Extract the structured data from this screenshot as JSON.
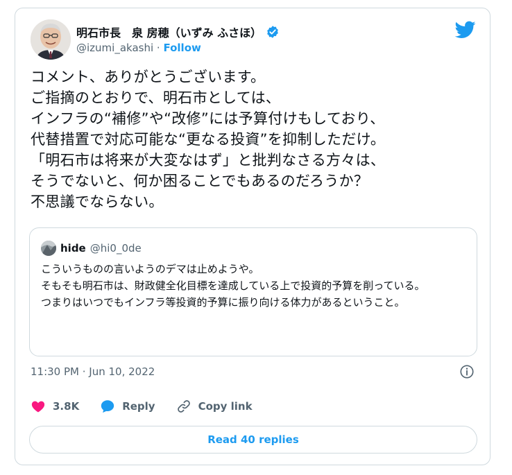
{
  "author": {
    "display_name": "明石市長　泉 房穂（いずみ ふさほ）",
    "handle": "@izumi_akashi",
    "separator": "·",
    "follow_label": "Follow"
  },
  "tweet": {
    "text": "コメント、ありがとうございます。\nご指摘のとおりで、明石市としては、\nインフラの“補修”や“改修”には予算付けもしており、\n代替措置で対応可能な“更なる投資”を抑制しただけ。\n「明石市は将来が大変なはず」と批判なさる方々は、\nそうでないと、何か困ることでもあるのだろうか？\n不思議でならない。",
    "timestamp": "11:30 PM · Jun 10, 2022"
  },
  "quoted_tweet": {
    "name": "hide",
    "handle": "@hi0_0de",
    "text": "こういうものの言いようのデマは止めようや。\nそもそも明石市は、財政健全化目標を達成している上で投資的予算を削っている。\nつまりはいつでもインフラ等投資的予算に振り向ける体力があるということ。"
  },
  "actions": {
    "like_count": "3.8K",
    "reply_label": "Reply",
    "copy_link_label": "Copy link",
    "read_replies_label": "Read 40 replies"
  },
  "colors": {
    "brand_blue": "#1d9bf0",
    "like_red": "#f91880",
    "secondary_text": "#536471",
    "border": "#cfd9de"
  },
  "icons": {
    "verified": "verified-badge-icon",
    "twitter": "twitter-bird-icon",
    "info": "info-icon",
    "like": "heart-icon",
    "reply": "speech-bubble-icon",
    "copy_link": "link-icon"
  }
}
